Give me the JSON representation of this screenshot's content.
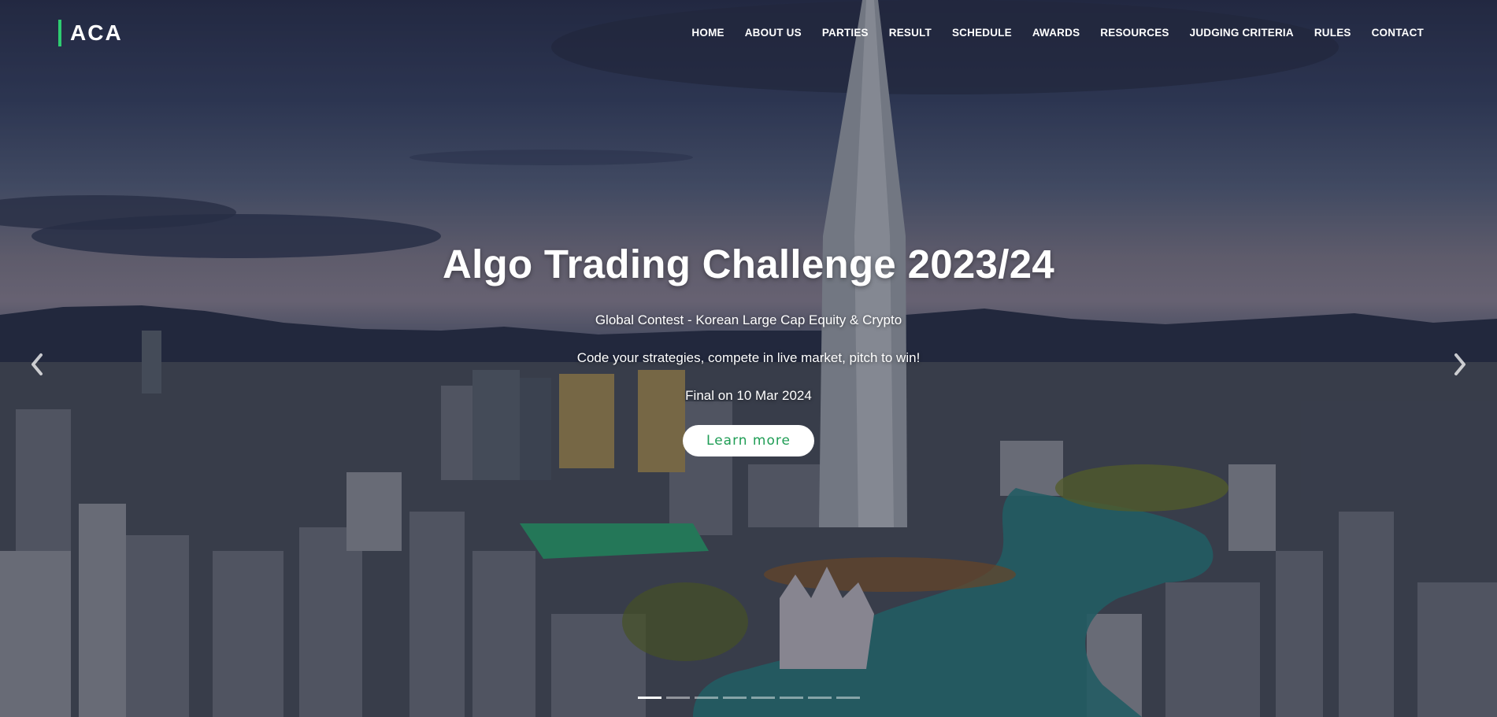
{
  "brand": {
    "logo_text": "ACA",
    "accent_color": "#2ecc71"
  },
  "nav": {
    "items": [
      {
        "label": "HOME"
      },
      {
        "label": "ABOUT US"
      },
      {
        "label": "PARTIES"
      },
      {
        "label": "RESULT"
      },
      {
        "label": "SCHEDULE"
      },
      {
        "label": "AWARDS"
      },
      {
        "label": "RESOURCES"
      },
      {
        "label": "JUDGING CRITERIA"
      },
      {
        "label": "RULES"
      },
      {
        "label": "CONTACT"
      }
    ]
  },
  "hero": {
    "title": "Algo Trading Challenge 2023/24",
    "subtitle": "Global Contest - Korean Large Cap Equity & Crypto",
    "tagline": "Code your strategies, compete in live market, pitch to win!",
    "final_date": "Final on 10 Mar 2024",
    "cta_label": "Learn more",
    "cta_color": "#1f9d55"
  },
  "carousel": {
    "prev_icon": "chevron-left-icon",
    "next_icon": "chevron-right-icon",
    "slide_count": 8,
    "active_index": 0
  }
}
